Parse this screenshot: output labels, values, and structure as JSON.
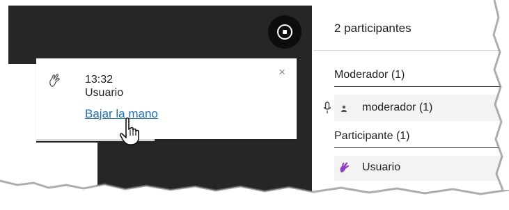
{
  "notification": {
    "time": "13:32",
    "user": "Usuario",
    "action": "Bajar la mano",
    "close": "×"
  },
  "panel": {
    "count": "2 participantes",
    "moderators_header": "Moderador (1)",
    "moderator_name": "moderador (1)",
    "participants_header": "Participante (1)",
    "participant_name": "Usuario"
  },
  "colors": {
    "stage": "#262626",
    "link": "#1f6fb2",
    "hand_purple": "#8e3fc6"
  },
  "icons": [
    "raise-hand-icon",
    "close-icon",
    "stop-icon",
    "microphone-icon",
    "person-icon",
    "hand-cursor-icon"
  ]
}
